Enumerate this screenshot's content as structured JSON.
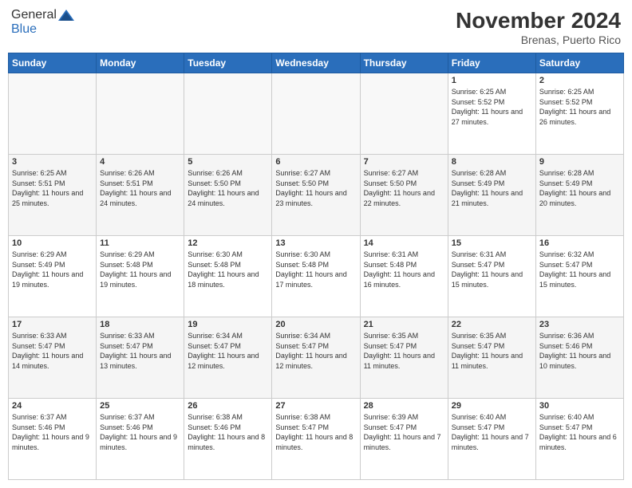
{
  "header": {
    "logo_general": "General",
    "logo_blue": "Blue",
    "month_title": "November 2024",
    "location": "Brenas, Puerto Rico"
  },
  "weekdays": [
    "Sunday",
    "Monday",
    "Tuesday",
    "Wednesday",
    "Thursday",
    "Friday",
    "Saturday"
  ],
  "weeks": [
    [
      {
        "day": "",
        "info": ""
      },
      {
        "day": "",
        "info": ""
      },
      {
        "day": "",
        "info": ""
      },
      {
        "day": "",
        "info": ""
      },
      {
        "day": "",
        "info": ""
      },
      {
        "day": "1",
        "info": "Sunrise: 6:25 AM\nSunset: 5:52 PM\nDaylight: 11 hours and 27 minutes."
      },
      {
        "day": "2",
        "info": "Sunrise: 6:25 AM\nSunset: 5:52 PM\nDaylight: 11 hours and 26 minutes."
      }
    ],
    [
      {
        "day": "3",
        "info": "Sunrise: 6:25 AM\nSunset: 5:51 PM\nDaylight: 11 hours and 25 minutes."
      },
      {
        "day": "4",
        "info": "Sunrise: 6:26 AM\nSunset: 5:51 PM\nDaylight: 11 hours and 24 minutes."
      },
      {
        "day": "5",
        "info": "Sunrise: 6:26 AM\nSunset: 5:50 PM\nDaylight: 11 hours and 24 minutes."
      },
      {
        "day": "6",
        "info": "Sunrise: 6:27 AM\nSunset: 5:50 PM\nDaylight: 11 hours and 23 minutes."
      },
      {
        "day": "7",
        "info": "Sunrise: 6:27 AM\nSunset: 5:50 PM\nDaylight: 11 hours and 22 minutes."
      },
      {
        "day": "8",
        "info": "Sunrise: 6:28 AM\nSunset: 5:49 PM\nDaylight: 11 hours and 21 minutes."
      },
      {
        "day": "9",
        "info": "Sunrise: 6:28 AM\nSunset: 5:49 PM\nDaylight: 11 hours and 20 minutes."
      }
    ],
    [
      {
        "day": "10",
        "info": "Sunrise: 6:29 AM\nSunset: 5:49 PM\nDaylight: 11 hours and 19 minutes."
      },
      {
        "day": "11",
        "info": "Sunrise: 6:29 AM\nSunset: 5:48 PM\nDaylight: 11 hours and 19 minutes."
      },
      {
        "day": "12",
        "info": "Sunrise: 6:30 AM\nSunset: 5:48 PM\nDaylight: 11 hours and 18 minutes."
      },
      {
        "day": "13",
        "info": "Sunrise: 6:30 AM\nSunset: 5:48 PM\nDaylight: 11 hours and 17 minutes."
      },
      {
        "day": "14",
        "info": "Sunrise: 6:31 AM\nSunset: 5:48 PM\nDaylight: 11 hours and 16 minutes."
      },
      {
        "day": "15",
        "info": "Sunrise: 6:31 AM\nSunset: 5:47 PM\nDaylight: 11 hours and 15 minutes."
      },
      {
        "day": "16",
        "info": "Sunrise: 6:32 AM\nSunset: 5:47 PM\nDaylight: 11 hours and 15 minutes."
      }
    ],
    [
      {
        "day": "17",
        "info": "Sunrise: 6:33 AM\nSunset: 5:47 PM\nDaylight: 11 hours and 14 minutes."
      },
      {
        "day": "18",
        "info": "Sunrise: 6:33 AM\nSunset: 5:47 PM\nDaylight: 11 hours and 13 minutes."
      },
      {
        "day": "19",
        "info": "Sunrise: 6:34 AM\nSunset: 5:47 PM\nDaylight: 11 hours and 12 minutes."
      },
      {
        "day": "20",
        "info": "Sunrise: 6:34 AM\nSunset: 5:47 PM\nDaylight: 11 hours and 12 minutes."
      },
      {
        "day": "21",
        "info": "Sunrise: 6:35 AM\nSunset: 5:47 PM\nDaylight: 11 hours and 11 minutes."
      },
      {
        "day": "22",
        "info": "Sunrise: 6:35 AM\nSunset: 5:47 PM\nDaylight: 11 hours and 11 minutes."
      },
      {
        "day": "23",
        "info": "Sunrise: 6:36 AM\nSunset: 5:46 PM\nDaylight: 11 hours and 10 minutes."
      }
    ],
    [
      {
        "day": "24",
        "info": "Sunrise: 6:37 AM\nSunset: 5:46 PM\nDaylight: 11 hours and 9 minutes."
      },
      {
        "day": "25",
        "info": "Sunrise: 6:37 AM\nSunset: 5:46 PM\nDaylight: 11 hours and 9 minutes."
      },
      {
        "day": "26",
        "info": "Sunrise: 6:38 AM\nSunset: 5:46 PM\nDaylight: 11 hours and 8 minutes."
      },
      {
        "day": "27",
        "info": "Sunrise: 6:38 AM\nSunset: 5:47 PM\nDaylight: 11 hours and 8 minutes."
      },
      {
        "day": "28",
        "info": "Sunrise: 6:39 AM\nSunset: 5:47 PM\nDaylight: 11 hours and 7 minutes."
      },
      {
        "day": "29",
        "info": "Sunrise: 6:40 AM\nSunset: 5:47 PM\nDaylight: 11 hours and 7 minutes."
      },
      {
        "day": "30",
        "info": "Sunrise: 6:40 AM\nSunset: 5:47 PM\nDaylight: 11 hours and 6 minutes."
      }
    ]
  ]
}
